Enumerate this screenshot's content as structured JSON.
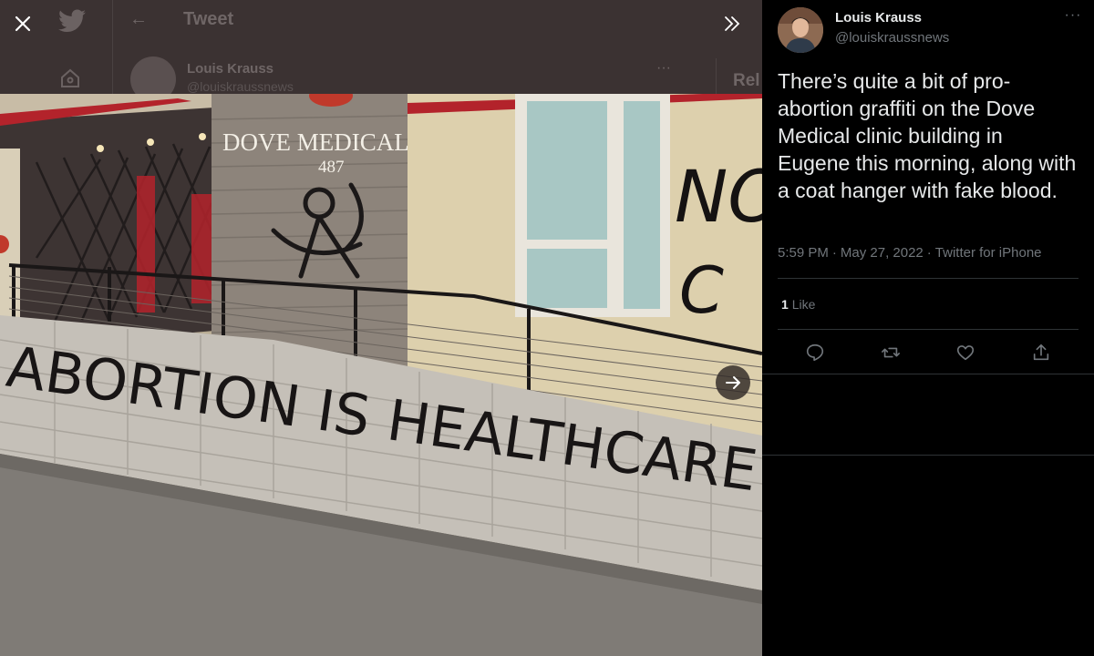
{
  "background": {
    "title": "Tweet",
    "author_name": "Louis Krauss",
    "author_handle": "@louiskraussnews",
    "relevant_label": "Rel"
  },
  "photo": {
    "sign_name": "DOVE MEDICAL",
    "sign_number": "487",
    "graffiti_main": "ABORTION IS HEALTHCARE",
    "graffiti_side_top": "NO",
    "graffiti_side_bottom": "C"
  },
  "tweet": {
    "author_name": "Louis Krauss",
    "author_handle": "@louiskraussnews",
    "text": "There’s quite a bit of pro-abortion graffiti on the Dove Medical clinic building in Eugene this morning, along with a coat hanger with fake blood.",
    "time": "5:59 PM",
    "date": "May 27, 2022",
    "source": "Twitter for iPhone",
    "separator": "·",
    "like_count": "1",
    "like_label": "Like"
  },
  "colors": {
    "panel_bg": "#000000",
    "text_primary": "#e7e9ea",
    "text_secondary": "#71767b",
    "divider": "#2f3336",
    "viewer_bg": "#3b3232"
  },
  "icons": {
    "close": "close-icon",
    "collapse": "double-chevron-right-icon",
    "next": "arrow-right-icon",
    "reply": "reply-icon",
    "retweet": "retweet-icon",
    "like": "heart-icon",
    "share": "share-icon",
    "more": "more-icon"
  }
}
